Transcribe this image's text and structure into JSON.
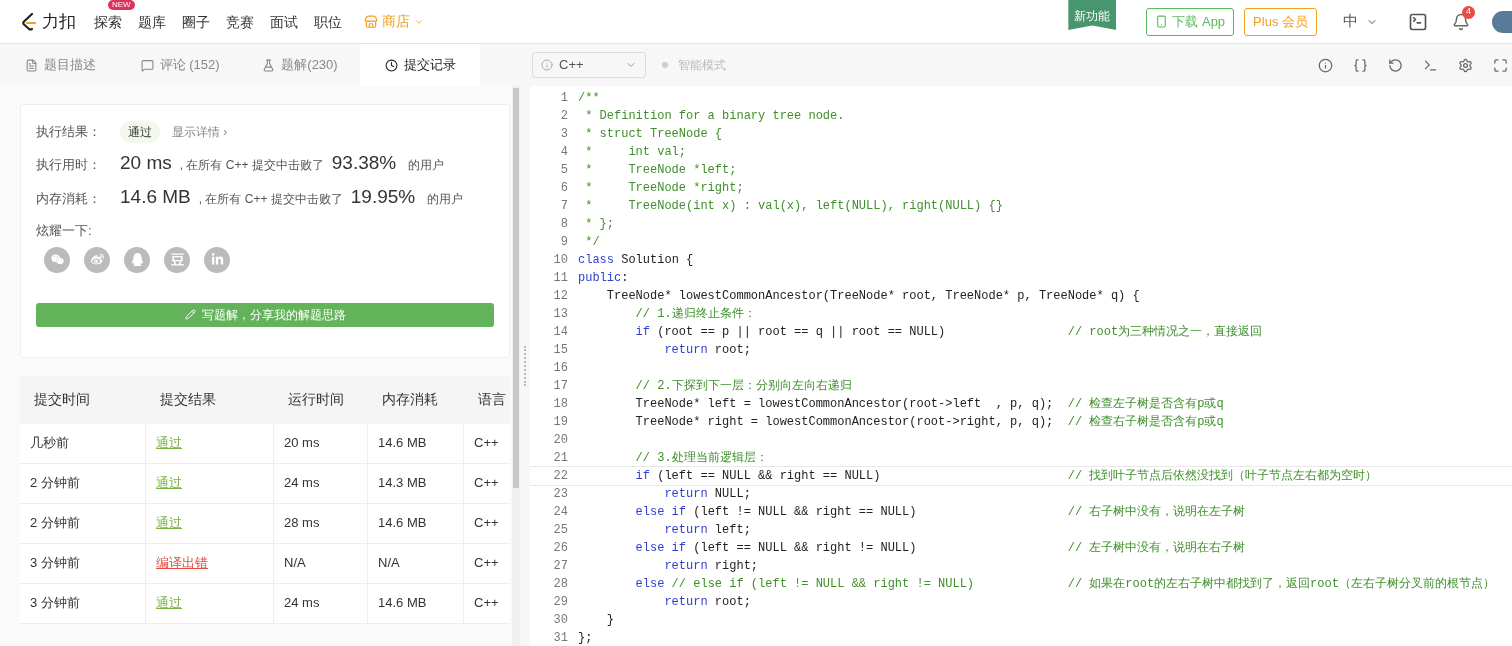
{
  "nav": {
    "logo": "力扣",
    "items": [
      {
        "label": "探索",
        "badge": "NEW",
        "kind": "plain"
      },
      {
        "label": "题库",
        "kind": "plain"
      },
      {
        "label": "圈子",
        "kind": "plain"
      },
      {
        "label": "竞赛",
        "kind": "plain"
      },
      {
        "label": "面试",
        "kind": "plain"
      },
      {
        "label": "职位",
        "kind": "plain"
      },
      {
        "label": "商店",
        "kind": "store"
      }
    ],
    "ribbon": "新功能",
    "download": "下载 App",
    "plus": "Plus 会员",
    "language": "中",
    "language_expanded": false,
    "notifications": "4"
  },
  "tabs": [
    {
      "label": "题目描述",
      "selected": false
    },
    {
      "label": "评论 (152)",
      "selected": false
    },
    {
      "label": "题解(230)",
      "selected": false
    },
    {
      "label": "提交记录",
      "selected": true
    }
  ],
  "editor_bar": {
    "lang": "C++",
    "smart_mode": "智能模式",
    "smart_on": false
  },
  "result": {
    "label": "执行结果：",
    "status": "通过",
    "details": "显示详情 ›",
    "time": {
      "label": "执行用时：",
      "value": "20 ms",
      "text": ", 在所有 C++ 提交中击败了",
      "percent": "93.38%",
      "suffix": "的用户"
    },
    "memory": {
      "label": "内存消耗：",
      "value": "14.6 MB",
      "text": ", 在所有 C++ 提交中击败了",
      "percent": "19.95%",
      "suffix": "的用户"
    },
    "share_label": "炫耀一下:",
    "share": [
      {
        "kind": "wechat"
      },
      {
        "kind": "weibo"
      },
      {
        "kind": "qq"
      },
      {
        "kind": "douban"
      },
      {
        "kind": "linkedin"
      }
    ],
    "write_button": "写题解，分享我的解题思路"
  },
  "table": {
    "columns": [
      "提交时间",
      "提交结果",
      "运行时间",
      "内存消耗",
      "语言"
    ],
    "rows": [
      {
        "time": "几秒前",
        "result": "通过",
        "kind": "accepted",
        "runtime": "20 ms",
        "memory": "14.6 MB",
        "lang": "C++"
      },
      {
        "time": "2 分钟前",
        "result": "通过",
        "kind": "accepted",
        "runtime": "24 ms",
        "memory": "14.3 MB",
        "lang": "C++"
      },
      {
        "time": "2 分钟前",
        "result": "通过",
        "kind": "accepted",
        "runtime": "28 ms",
        "memory": "14.6 MB",
        "lang": "C++"
      },
      {
        "time": "3 分钟前",
        "result": "编译出错",
        "kind": "error",
        "runtime": "N/A",
        "memory": "N/A",
        "lang": "C++"
      },
      {
        "time": "3 分钟前",
        "result": "通过",
        "kind": "accepted",
        "runtime": "24 ms",
        "memory": "14.6 MB",
        "lang": "C++"
      }
    ]
  },
  "code": [
    {
      "n": "1",
      "current": false,
      "segs": [
        {
          "kind": "comment",
          "text": "/**"
        }
      ]
    },
    {
      "n": "2",
      "current": false,
      "segs": [
        {
          "kind": "comment",
          "text": " * Definition for a binary tree node."
        }
      ]
    },
    {
      "n": "3",
      "current": false,
      "segs": [
        {
          "kind": "comment",
          "text": " * struct TreeNode {"
        }
      ]
    },
    {
      "n": "4",
      "current": false,
      "segs": [
        {
          "kind": "comment",
          "text": " *     int val;"
        }
      ]
    },
    {
      "n": "5",
      "current": false,
      "segs": [
        {
          "kind": "comment",
          "text": " *     TreeNode *left;"
        }
      ]
    },
    {
      "n": "6",
      "current": false,
      "segs": [
        {
          "kind": "comment",
          "text": " *     TreeNode *right;"
        }
      ]
    },
    {
      "n": "7",
      "current": false,
      "segs": [
        {
          "kind": "comment",
          "text": " *     TreeNode(int x) : val(x), left(NULL), right(NULL) {}"
        }
      ]
    },
    {
      "n": "8",
      "current": false,
      "segs": [
        {
          "kind": "comment",
          "text": " * };"
        }
      ]
    },
    {
      "n": "9",
      "current": false,
      "segs": [
        {
          "kind": "comment",
          "text": " */"
        }
      ]
    },
    {
      "n": "10",
      "current": false,
      "segs": [
        {
          "kind": "keyword",
          "text": "class"
        },
        {
          "kind": "plain",
          "text": " Solution {"
        }
      ]
    },
    {
      "n": "11",
      "current": false,
      "segs": [
        {
          "kind": "keyword",
          "text": "public"
        },
        {
          "kind": "plain",
          "text": ":"
        }
      ]
    },
    {
      "n": "12",
      "current": false,
      "segs": [
        {
          "kind": "plain",
          "text": "    TreeNode* lowestCommonAncestor(TreeNode* root, TreeNode* p, TreeNode* q) {"
        }
      ]
    },
    {
      "n": "13",
      "current": false,
      "segs": [
        {
          "kind": "comment",
          "text": "        // 1.递归终止条件："
        }
      ]
    },
    {
      "n": "14",
      "current": false,
      "segs": [
        {
          "kind": "keyword",
          "text": "        if"
        },
        {
          "kind": "plain",
          "text": " (root == p || root == q || root == NULL)"
        },
        {
          "kind": "comment",
          "text": "                 // root为三种情况之一，直接返回"
        }
      ]
    },
    {
      "n": "15",
      "current": false,
      "segs": [
        {
          "kind": "keyword",
          "text": "            return"
        },
        {
          "kind": "plain",
          "text": " root;"
        }
      ]
    },
    {
      "n": "16",
      "current": false
    },
    {
      "n": "17",
      "current": false,
      "segs": [
        {
          "kind": "comment",
          "text": "        // 2.下探到下一层：分别向左向右递归"
        }
      ]
    },
    {
      "n": "18",
      "current": false,
      "segs": [
        {
          "kind": "plain",
          "text": "        TreeNode* left = lowestCommonAncestor(root->left  , p, q);"
        },
        {
          "kind": "comment",
          "text": "  // 检查左子树是否含有p或q"
        }
      ]
    },
    {
      "n": "19",
      "current": false,
      "segs": [
        {
          "kind": "plain",
          "text": "        TreeNode* right = lowestCommonAncestor(root->right, p, q);"
        },
        {
          "kind": "comment",
          "text": "  // 检查右子树是否含有p或q"
        }
      ]
    },
    {
      "n": "20",
      "current": false
    },
    {
      "n": "21",
      "current": false,
      "segs": [
        {
          "kind": "comment",
          "text": "        // 3.处理当前逻辑层："
        }
      ]
    },
    {
      "n": "22",
      "current": true,
      "segs": [
        {
          "kind": "keyword",
          "text": "        if"
        },
        {
          "kind": "plain",
          "text": " (left == NULL && right == NULL)"
        },
        {
          "kind": "comment",
          "text": "                          // 找到叶子节点后依然没找到（叶子节点左右都为空时）"
        }
      ]
    },
    {
      "n": "23",
      "current": false,
      "segs": [
        {
          "kind": "keyword",
          "text": "            return"
        },
        {
          "kind": "plain",
          "text": " NULL;"
        }
      ]
    },
    {
      "n": "24",
      "current": false,
      "segs": [
        {
          "kind": "keyword",
          "text": "        else if"
        },
        {
          "kind": "plain",
          "text": " (left != NULL && right == NULL)"
        },
        {
          "kind": "comment",
          "text": "                     // 右子树中没有，说明在左子树"
        }
      ]
    },
    {
      "n": "25",
      "current": false,
      "segs": [
        {
          "kind": "keyword",
          "text": "            return"
        },
        {
          "kind": "plain",
          "text": " left;"
        }
      ]
    },
    {
      "n": "26",
      "current": false,
      "segs": [
        {
          "kind": "keyword",
          "text": "        else if"
        },
        {
          "kind": "plain",
          "text": " (left == NULL && right != NULL)"
        },
        {
          "kind": "comment",
          "text": "                     // 左子树中没有，说明在右子树"
        }
      ]
    },
    {
      "n": "27",
      "current": false,
      "segs": [
        {
          "kind": "keyword",
          "text": "            return"
        },
        {
          "kind": "plain",
          "text": " right;"
        }
      ]
    },
    {
      "n": "28",
      "current": false,
      "segs": [
        {
          "kind": "keyword",
          "text": "        else"
        },
        {
          "kind": "comment",
          "text": " // else if (left != NULL && right != NULL)             // 如果在root的左右子树中都找到了，返回root（左右子树分叉前的根节点）"
        }
      ]
    },
    {
      "n": "29",
      "current": false,
      "segs": [
        {
          "kind": "keyword",
          "text": "            return"
        },
        {
          "kind": "plain",
          "text": " root;"
        }
      ]
    },
    {
      "n": "30",
      "current": false,
      "segs": [
        {
          "kind": "plain",
          "text": "    }"
        }
      ]
    },
    {
      "n": "31",
      "current": false,
      "segs": [
        {
          "kind": "plain",
          "text": "};"
        }
      ]
    }
  ]
}
